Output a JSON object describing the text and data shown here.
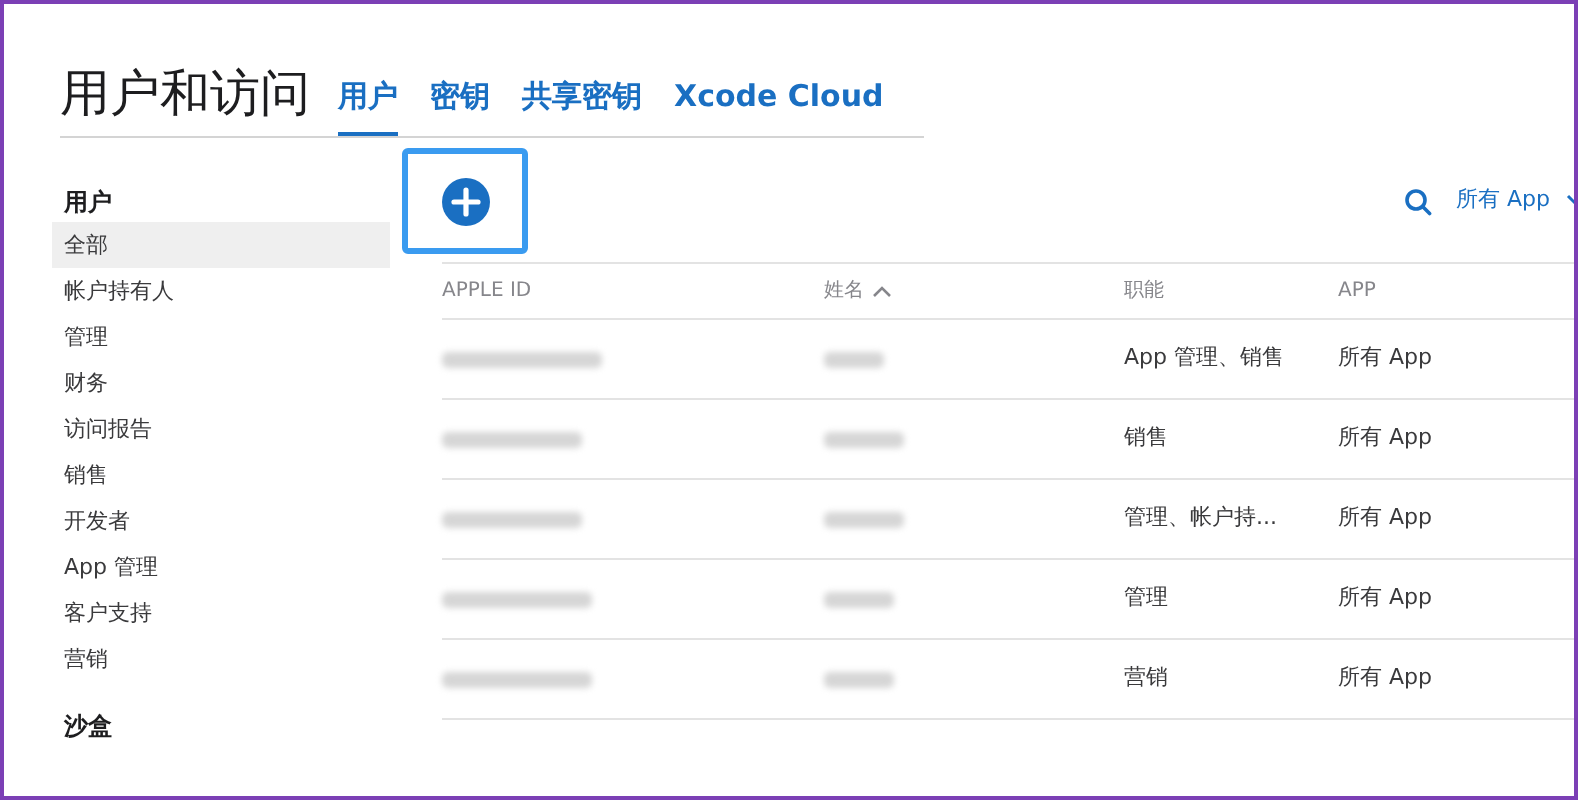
{
  "page_title": "用户和访问",
  "tabs": [
    {
      "label": "用户",
      "selected": true
    },
    {
      "label": "密钥",
      "selected": false
    },
    {
      "label": "共享密钥",
      "selected": false
    },
    {
      "label": "Xcode Cloud",
      "selected": false
    }
  ],
  "sidebar": [
    {
      "heading": "用户",
      "items": [
        {
          "label": "全部",
          "selected": true
        },
        {
          "label": "帐户持有人",
          "selected": false
        },
        {
          "label": "管理",
          "selected": false
        },
        {
          "label": "财务",
          "selected": false
        },
        {
          "label": "访问报告",
          "selected": false
        },
        {
          "label": "销售",
          "selected": false
        },
        {
          "label": "开发者",
          "selected": false
        },
        {
          "label": "App 管理",
          "selected": false
        },
        {
          "label": "客户支持",
          "selected": false
        },
        {
          "label": "营销",
          "selected": false
        }
      ]
    },
    {
      "heading": "沙盒"
    }
  ],
  "filter": {
    "label": "所有 App"
  },
  "table": {
    "columns": [
      {
        "label": "APPLE ID",
        "sorted": false
      },
      {
        "label": "姓名",
        "sorted": true
      },
      {
        "label": "职能",
        "sorted": false
      },
      {
        "label": "APP",
        "sorted": false
      }
    ],
    "rows": [
      {
        "role": "App 管理、销售",
        "apps": "所有 App"
      },
      {
        "role": "销售",
        "apps": "所有 App"
      },
      {
        "role": "管理、帐户持...",
        "apps": "所有 App"
      },
      {
        "role": "管理",
        "apps": "所有 App"
      },
      {
        "role": "营销",
        "apps": "所有 App"
      }
    ]
  }
}
